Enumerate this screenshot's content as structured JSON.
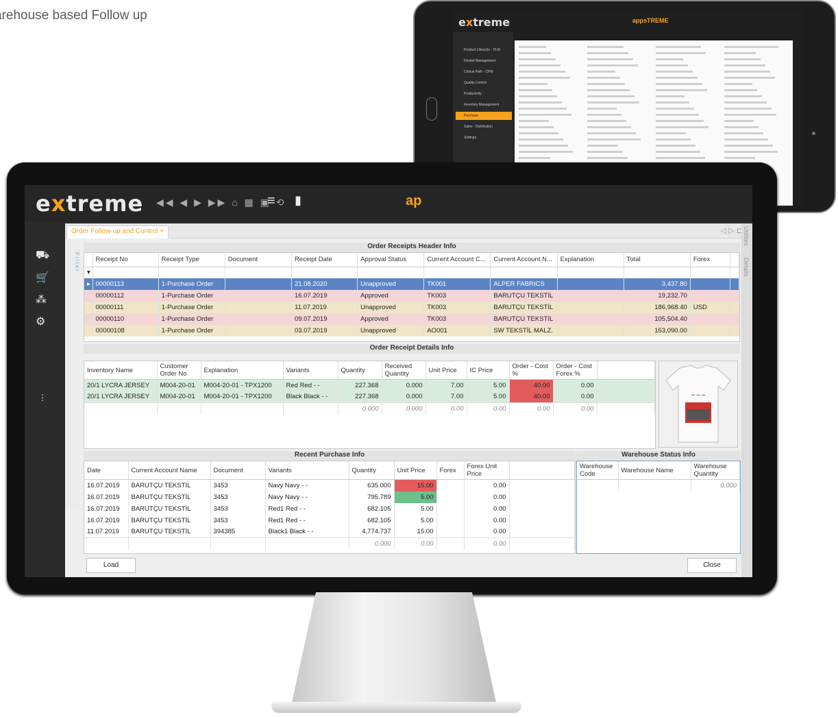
{
  "caption": "arehouse based Follow up",
  "app": {
    "logo_pre": "e",
    "logo_x": "x",
    "logo_post": "treme",
    "apps_label": "ap",
    "nav_icons": "◀◀ ◀ ▶ ▶▶ ⌂ ▦ ▣ ⟲",
    "menu_icon": "≡",
    "bookmark_icon": "▮"
  },
  "tab": {
    "label": "Order Follow-up and Control",
    "close": "×"
  },
  "filter_label": "Filter",
  "right_rail": {
    "a": "Utilities",
    "b": "Details"
  },
  "header_section": {
    "title": "Order Receipts Header Info",
    "columns": [
      "Receipt No",
      "Receipt Type",
      "Document",
      "Receipt Date",
      "Approval Status",
      "Current Account C...",
      "Current Account N...",
      "Explanation",
      "Total",
      "Forex"
    ],
    "rows": [
      {
        "no": "00000113",
        "type": "1-Purchase Order",
        "doc": "",
        "date": "21.08.2020",
        "status": "Unapproved",
        "acc_code": "TK001",
        "acc_name": "ALPER FABRICS",
        "expl": "",
        "total": "3,437.80",
        "forex": "",
        "style": "sel"
      },
      {
        "no": "00000112",
        "type": "1-Purchase Order",
        "doc": "",
        "date": "16.07.2019",
        "status": "Approved",
        "acc_code": "TK003",
        "acc_name": "BARUTÇU TEKSTİL",
        "expl": "",
        "total": "19,232.70",
        "forex": "",
        "style": "pink"
      },
      {
        "no": "00000111",
        "type": "1-Purchase Order",
        "doc": "",
        "date": "11.07.2019",
        "status": "Unapproved",
        "acc_code": "TK003",
        "acc_name": "BARUTÇU TEKSTİL",
        "expl": "",
        "total": "186,968.40",
        "forex": "USD",
        "style": "tan"
      },
      {
        "no": "00000110",
        "type": "1-Purchase Order",
        "doc": "",
        "date": "09.07.2019",
        "status": "Approved",
        "acc_code": "TK003",
        "acc_name": "BARUTÇU TEKSTİL",
        "expl": "",
        "total": "105,504.40",
        "forex": "",
        "style": "pink"
      },
      {
        "no": "00000108",
        "type": "1-Purchase Order",
        "doc": "",
        "date": "03.07.2019",
        "status": "Unapproved",
        "acc_code": "AO001",
        "acc_name": "SW TEKSTİL MALZ.",
        "expl": "",
        "total": "153,090.00",
        "forex": "",
        "style": "tan"
      }
    ]
  },
  "details_section": {
    "title": "Order Receipt Details Info",
    "columns": [
      "Inventory Name",
      "Customer Order No",
      "Explanation",
      "Variants",
      "Quantity",
      "Received Quantity",
      "Unit Price",
      "IC Price",
      "Order - Cost %",
      "Order - Cost Forex %"
    ],
    "rows": [
      {
        "inv": "20/1 LYCRA JERSEY",
        "cust": "M004-20-01",
        "expl": "M004-20-01 - TPX1200",
        "var": "Red Red - -",
        "qty": "227.368",
        "recv": "0.000",
        "price": "7.00",
        "ic": "5.00",
        "cost": "40.00",
        "costfx": "0.00"
      },
      {
        "inv": "20/1 LYCRA JERSEY",
        "cust": "M004-20-01",
        "expl": "M004-20-01 - TPX1200",
        "var": "Black Black - -",
        "qty": "227.368",
        "recv": "0.000",
        "price": "7.00",
        "ic": "5.00",
        "cost": "40.00",
        "costfx": "0.00"
      }
    ],
    "summary": {
      "qty": "0.000",
      "recv": "0.000",
      "price": "0.00",
      "ic": "0.00",
      "cost": "0.00",
      "costfx": "0.00"
    }
  },
  "recent_section": {
    "title": "Recent Purchase Info",
    "columns": [
      "Date",
      "Current Account Name",
      "Document",
      "Variants",
      "Quantity",
      "Unit Price",
      "Forex",
      "Forex Unit Price"
    ],
    "rows": [
      {
        "date": "16.07.2019",
        "acc": "BARUTÇU TEKSTİL",
        "doc": "3453",
        "var": "Navy Navy - -",
        "qty": "635.000",
        "price": "15.00",
        "forex": "",
        "fxp": "0.00",
        "hl": "red"
      },
      {
        "date": "16.07.2019",
        "acc": "BARUTÇU TEKSTİL",
        "doc": "3453",
        "var": "Navy Navy - -",
        "qty": "795.789",
        "price": "5.00",
        "forex": "",
        "fxp": "0.00",
        "hl": "green"
      },
      {
        "date": "16.07.2019",
        "acc": "BARUTÇU TEKSTİL",
        "doc": "3453",
        "var": "Red1 Red - -",
        "qty": "682.105",
        "price": "5.00",
        "forex": "",
        "fxp": "0.00",
        "hl": ""
      },
      {
        "date": "16.07.2019",
        "acc": "BARUTÇU TEKSTİL",
        "doc": "3453",
        "var": "Red1 Red - -",
        "qty": "682.105",
        "price": "5.00",
        "forex": "",
        "fxp": "0.00",
        "hl": ""
      },
      {
        "date": "11.07.2019",
        "acc": "BARUTÇU TEKSTİL",
        "doc": "394385",
        "var": "Black1 Black - -",
        "qty": "4,774.737",
        "price": "15.00",
        "forex": "",
        "fxp": "0.00",
        "hl": ""
      }
    ],
    "summary": {
      "qty": "0.000",
      "price": "0.00",
      "fxp": "0.00"
    }
  },
  "warehouse_section": {
    "title": "Warehouse Status Info",
    "columns": [
      "Warehouse Code",
      "Warehouse Name",
      "Warehouse Quantity"
    ],
    "summary": "0.000"
  },
  "buttons": {
    "load": "Load",
    "close": "Close"
  },
  "tablet": {
    "logo_pre": "e",
    "logo_x": "x",
    "logo_post": "treme",
    "apps": "appsTREME",
    "menu": [
      "Product Lifecycle - PLM",
      "Docket Management",
      "Critical Path - CPM",
      "Quality Control",
      "Productivity",
      "Inventory Management",
      "Purchase",
      "Sales - Distribution",
      "Settings"
    ],
    "active": "Purchase"
  },
  "colors": {
    "accent": "#f7a21b",
    "selected": "#5b84c4",
    "pink": "#f4d6d6",
    "tan": "#efe5c8",
    "green": "#d8ecde",
    "red": "#e25c5c"
  }
}
